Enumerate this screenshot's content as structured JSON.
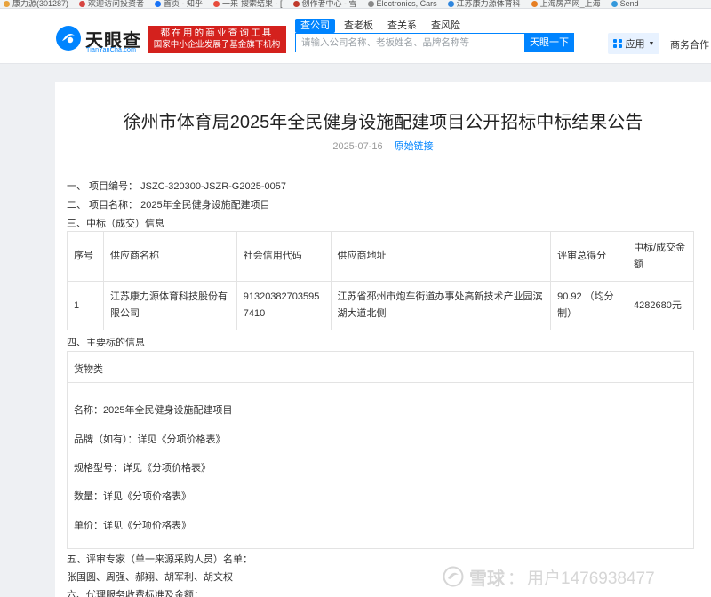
{
  "bookmarks": [
    "康力源(301287)",
    "欢迎访问投资者",
    "首页 - 知乎",
    "一来·搜索结果 - [",
    "创作者中心 - 雪",
    "Electronics, Cars",
    "江苏康力源体育科",
    "上海房产网_上海",
    "Send"
  ],
  "header": {
    "logo_text": "天眼查",
    "logo_domain": "TianYanCha.com",
    "slogan_line1": "都在用的商业查询工具",
    "slogan_line2": "国家中小企业发展子基金旗下机构",
    "search_tabs": [
      "查公司",
      "查老板",
      "查关系",
      "查风险"
    ],
    "active_tab": 0,
    "search_placeholder": "请输入公司名称、老板姓名、品牌名称等",
    "search_button": "天眼一下",
    "app_button": "应用",
    "business_link": "商务合作",
    "brand_color": "#0084ff",
    "slogan_color": "#d4211d"
  },
  "article": {
    "title": "徐州市体育局2025年全民健身设施配建项目公开招标中标结果公告",
    "date": "2025-07-16",
    "source_link": "原始链接",
    "section1": "一、 项目编号： JSZC-320300-JSZR-G2025-0057",
    "section2": "二、 项目名称： 2025年全民健身设施配建项目",
    "section3": "三、中标（成交）信息",
    "table": {
      "headers": [
        "序号",
        "供应商名称",
        "社会信用代码",
        "供应商地址",
        "评审总得分",
        "中标/成交金额"
      ],
      "rows": [
        [
          "1",
          "江苏康力源体育科技股份有限公司",
          "913203827035957410",
          "江苏省邳州市炮车街道办事处高新技术产业园滨湖大道北侧",
          "90.92 （均分制）",
          "4282680元"
        ]
      ]
    },
    "section4": "四、主要标的信息",
    "goods": {
      "category": "货物类",
      "name": "名称：2025年全民健身设施配建项目",
      "brand": "品牌（如有）：详见《分项价格表》",
      "spec": "规格型号：详见《分项价格表》",
      "quantity": "数量：详见《分项价格表》",
      "price": "单价：详见《分项价格表》"
    },
    "section5": "五、评审专家（单一来源采购人员）名单：",
    "experts": "张国圆、周强、郝翔、胡军利、胡文权",
    "section6": "六、代理服务收费标准及金额："
  },
  "watermark": {
    "brand": "雪球",
    "colon": "：",
    "user": "用户1476938477"
  }
}
